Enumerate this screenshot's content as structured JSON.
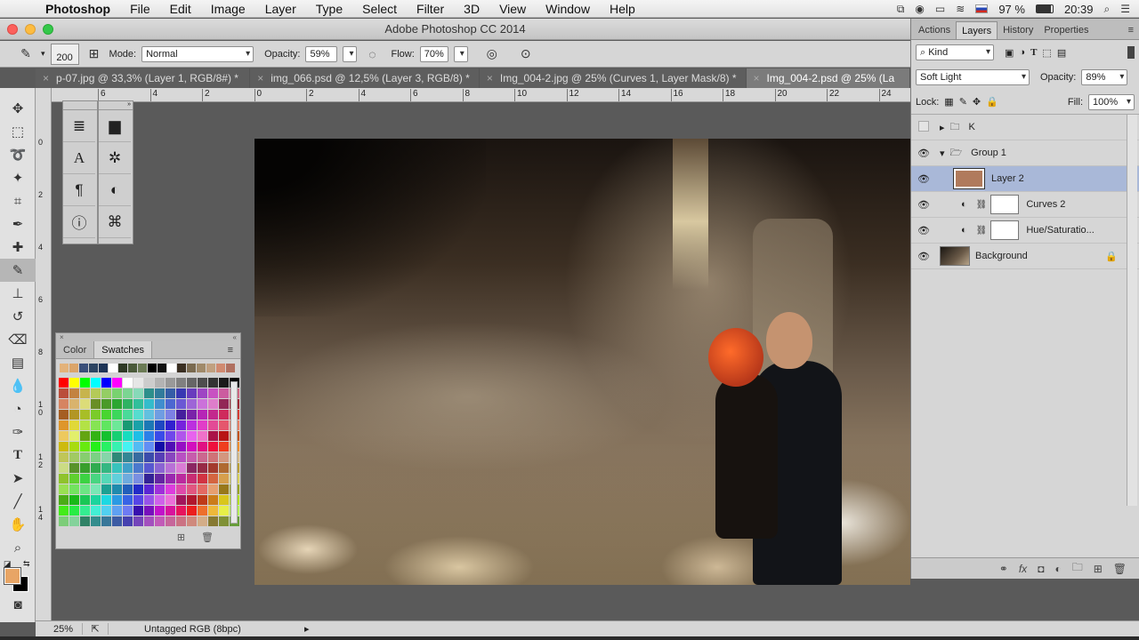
{
  "menubar": {
    "app": "Photoshop",
    "items": [
      "File",
      "Edit",
      "Image",
      "Layer",
      "Type",
      "Select",
      "Filter",
      "3D",
      "View",
      "Window",
      "Help"
    ],
    "battery": "97 %",
    "time": "20:39"
  },
  "window": {
    "title": "Adobe Photoshop CC 2014"
  },
  "options": {
    "brush_size": "200",
    "mode_label": "Mode:",
    "mode_value": "Normal",
    "opacity_label": "Opacity:",
    "opacity_value": "59%",
    "flow_label": "Flow:",
    "flow_value": "70%"
  },
  "tabs": [
    {
      "label": "p-07.jpg @ 33,3% (Layer 1, RGB/8#) *"
    },
    {
      "label": "img_066.psd @ 12,5% (Layer 3, RGB/8) *"
    },
    {
      "label": "Img_004-2.jpg @ 25% (Curves 1, Layer Mask/8) *"
    },
    {
      "label": "Img_004-2.psd @ 25% (La"
    }
  ],
  "hruler_ticks": [
    "6",
    "4",
    "2",
    "0",
    "2",
    "4",
    "6",
    "8",
    "10",
    "12",
    "14",
    "16",
    "18",
    "20",
    "22",
    "24"
  ],
  "vruler_ticks": [
    "0",
    "2",
    "4",
    "6",
    "8",
    "1 0",
    "1 2",
    "1 4"
  ],
  "swatches_panel": {
    "tabs": [
      "Color",
      "Swatches"
    ],
    "recent_colors": [
      "#e3b27a",
      "#dba56a",
      "#3a4f7a",
      "#2d4462",
      "#1e3557",
      "#ffffff",
      "#2f3a25",
      "#4a5a3a",
      "#6b7b55",
      "#000000",
      "#111111",
      "#ffffff",
      "#3a2f22",
      "#7a6a50",
      "#a08a6a",
      "#c0a080",
      "#d08a70",
      "#b07060"
    ],
    "grid_colors": [
      "#ff0000",
      "#ffff00",
      "#00ff00",
      "#00ffff",
      "#0000ff",
      "#ff00ff",
      "#ffffff",
      "#e6e6e6",
      "#cccccc",
      "#b3b3b3",
      "#999999",
      "#808080",
      "#666666",
      "#4d4d4d",
      "#333333",
      "#1a1a1a",
      "#000000"
    ]
  },
  "layers_panel": {
    "tabs": [
      "Actions",
      "Layers",
      "History",
      "Properties"
    ],
    "filter": "Kind",
    "blend_mode": "Soft Light",
    "opacity_label": "Opacity:",
    "opacity_value": "89%",
    "lock_label": "Lock:",
    "fill_label": "Fill:",
    "fill_value": "100%",
    "layers": [
      {
        "name": "K",
        "kind": "group-collapsed",
        "visible": false
      },
      {
        "name": "Group 1",
        "kind": "group-open",
        "visible": true
      },
      {
        "name": "Layer 2",
        "kind": "pixel",
        "visible": true,
        "selected": true,
        "thumb_color": "#b07a5c"
      },
      {
        "name": "Curves 2",
        "kind": "adjustment",
        "visible": true
      },
      {
        "name": "Hue/Saturatio...",
        "kind": "adjustment",
        "visible": true
      },
      {
        "name": "Background",
        "kind": "background",
        "visible": true,
        "locked": true
      }
    ]
  },
  "status": {
    "zoom": "25%",
    "profile": "Untagged RGB (8bpc)"
  }
}
